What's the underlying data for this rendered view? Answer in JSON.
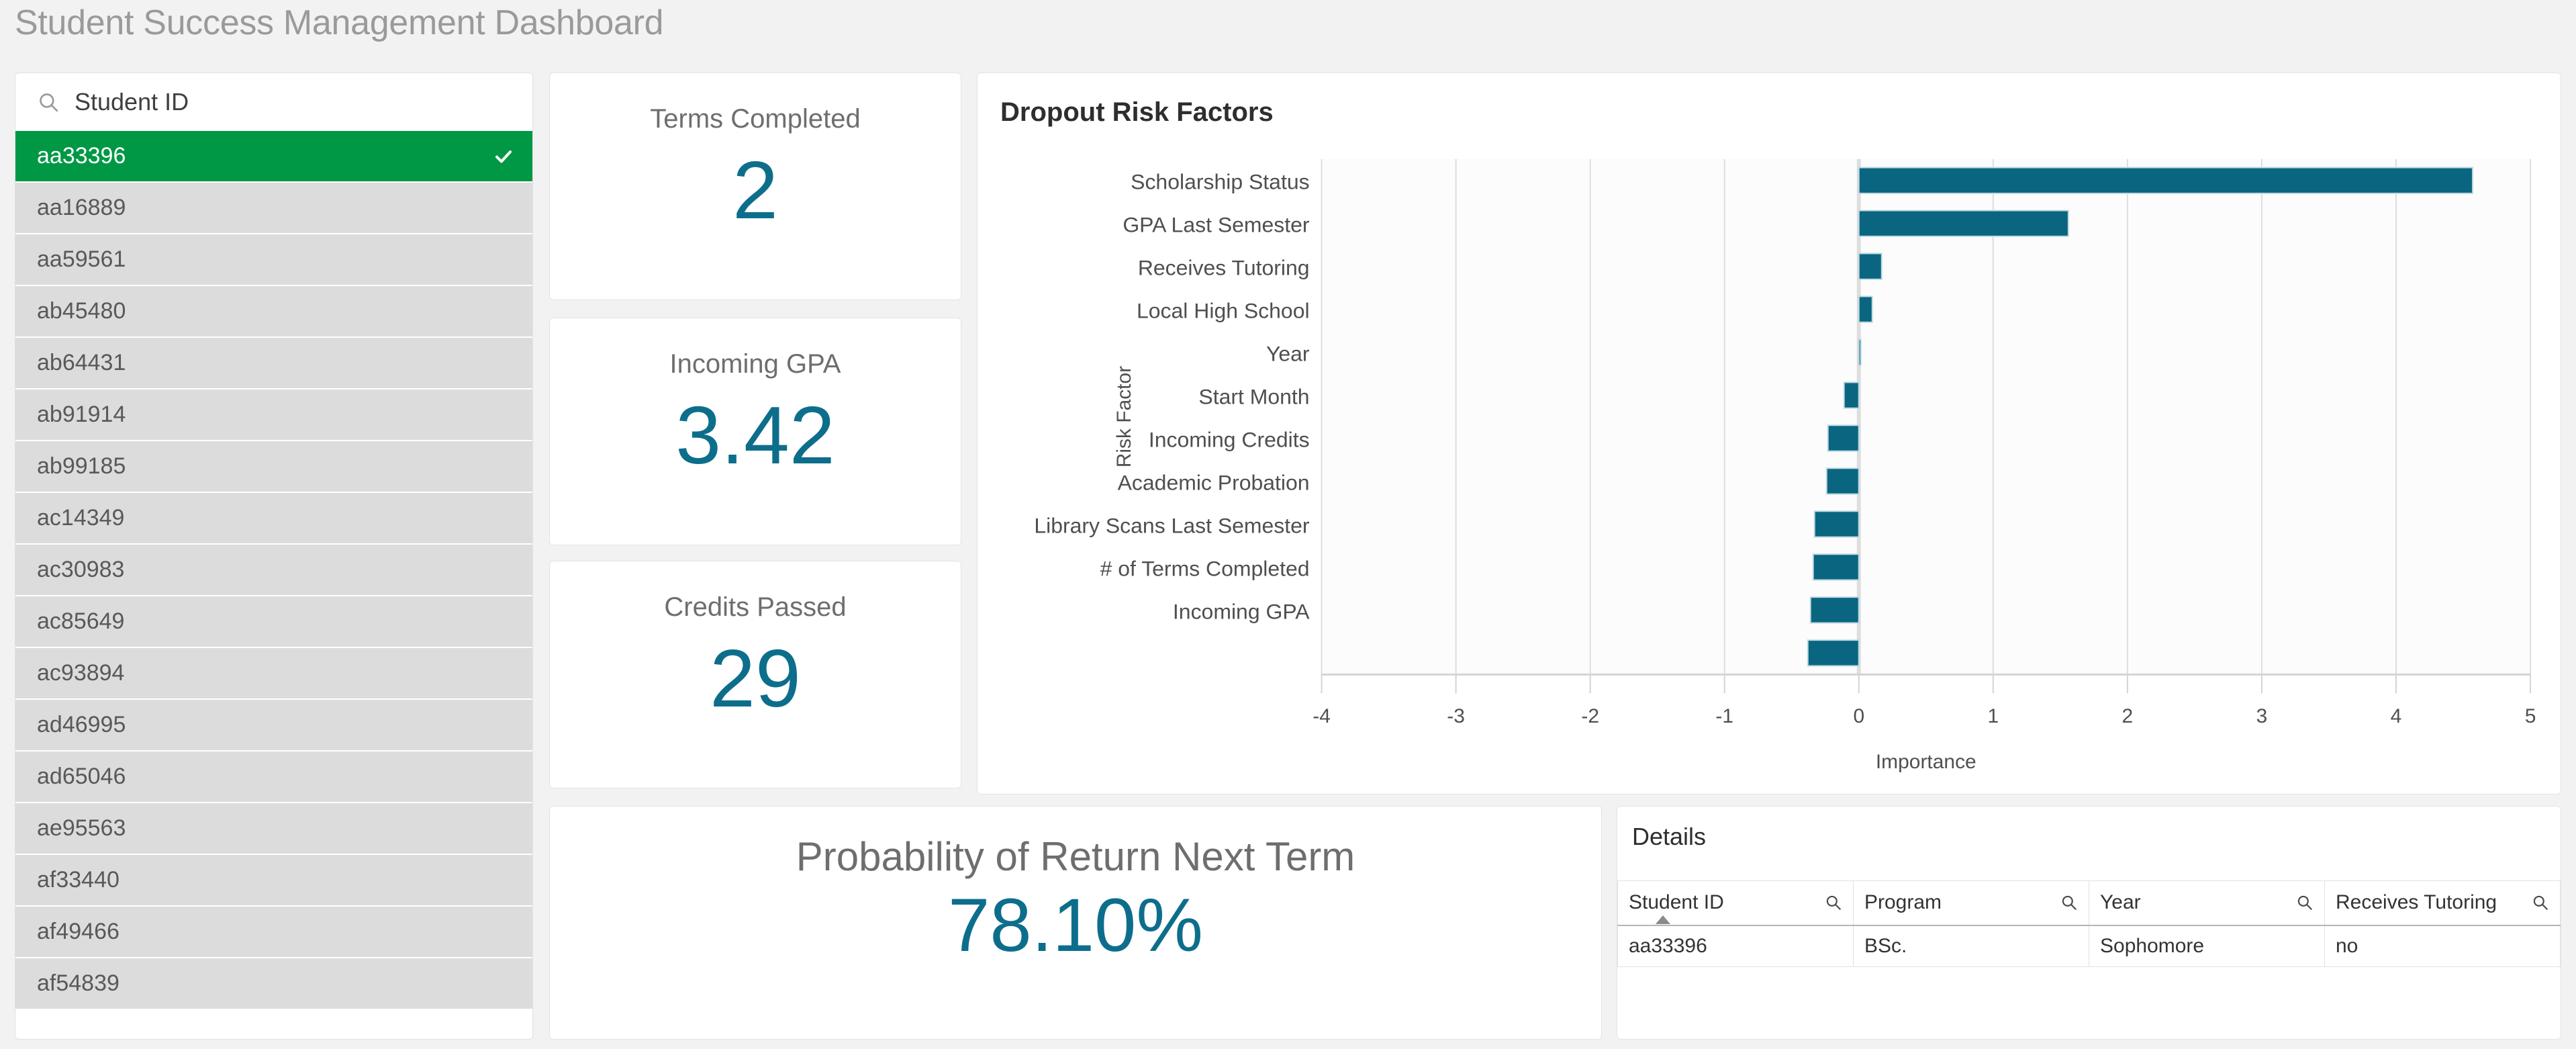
{
  "header": {
    "title": "Student Success Management Dashboard"
  },
  "selector": {
    "search_placeholder": "Student ID",
    "search_value": "",
    "search_icon": "search-icon",
    "selected_icon": "check-icon",
    "selected_id": "aa33396",
    "items": [
      {
        "id": "aa33396",
        "selected": true
      },
      {
        "id": "aa16889",
        "selected": false
      },
      {
        "id": "aa59561",
        "selected": false
      },
      {
        "id": "ab45480",
        "selected": false
      },
      {
        "id": "ab64431",
        "selected": false
      },
      {
        "id": "ab91914",
        "selected": false
      },
      {
        "id": "ab99185",
        "selected": false
      },
      {
        "id": "ac14349",
        "selected": false
      },
      {
        "id": "ac30983",
        "selected": false
      },
      {
        "id": "ac85649",
        "selected": false
      },
      {
        "id": "ac93894",
        "selected": false
      },
      {
        "id": "ad46995",
        "selected": false
      },
      {
        "id": "ad65046",
        "selected": false
      },
      {
        "id": "ae95563",
        "selected": false
      },
      {
        "id": "af33440",
        "selected": false
      },
      {
        "id": "af49466",
        "selected": false
      },
      {
        "id": "af54839",
        "selected": false
      }
    ]
  },
  "kpis": {
    "terms_completed": {
      "title": "Terms Completed",
      "value": "2"
    },
    "incoming_gpa": {
      "title": "Incoming GPA",
      "value": "3.42"
    },
    "credits_passed": {
      "title": "Credits Passed",
      "value": "29"
    },
    "probability": {
      "title": "Probability of Return Next Term",
      "value": "78.10%"
    }
  },
  "details": {
    "title": "Details",
    "search_icon": "search-icon",
    "sort_column": "Student ID",
    "sort_direction": "ascending",
    "columns": [
      "Student ID",
      "Program",
      "Year",
      "Receives Tutoring"
    ],
    "rows": [
      [
        "aa33396",
        "BSc.",
        "Sophomore",
        "no"
      ]
    ]
  },
  "colors": {
    "accent_teal": "#0d6e8c",
    "bar_fill": "#0a6680",
    "selection_green": "#009845",
    "title_grey": "#9a9a9a",
    "panel_bg": "#ffffff",
    "page_bg": "#f2f2f2"
  },
  "chart_data": {
    "type": "bar",
    "orientation": "horizontal",
    "title": "Dropout Risk Factors",
    "xlabel": "Importance",
    "ylabel": "Risk Factor",
    "xlim": [
      -4,
      5
    ],
    "xticks": [
      -4,
      -3,
      -2,
      -1,
      0,
      1,
      2,
      3,
      4,
      5
    ],
    "grid": true,
    "legend": "none",
    "categories": [
      "Scholarship Status",
      "GPA Last Semester",
      "Receives Tutoring",
      "Local High School",
      "Year",
      "Start Month",
      "Incoming Credits",
      "Academic Probation",
      "Library Scans Last Semester",
      "# of Terms Completed",
      "Incoming GPA",
      ""
    ],
    "values": [
      4.57,
      1.56,
      0.17,
      0.1,
      0.01,
      -0.11,
      -0.23,
      -0.24,
      -0.33,
      -0.34,
      -0.36,
      -0.38
    ]
  }
}
